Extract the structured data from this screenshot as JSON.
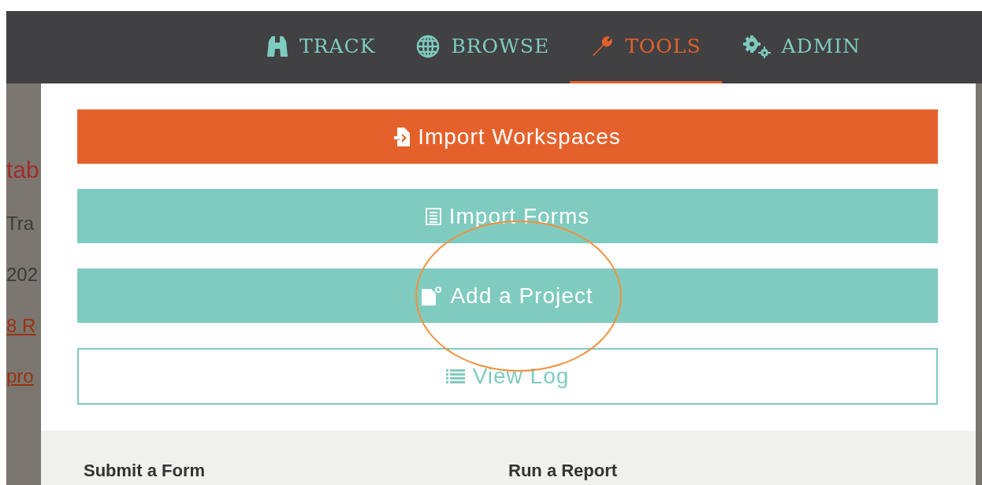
{
  "nav": [
    {
      "label": "TRACK",
      "selected": false
    },
    {
      "label": "BROWSE",
      "selected": false
    },
    {
      "label": "TOOLS",
      "selected": true
    },
    {
      "label": "ADMIN",
      "selected": false
    }
  ],
  "background_page": [
    {
      "kind": "heading",
      "text": "tab"
    },
    {
      "kind": "text",
      "text": "Tra"
    },
    {
      "kind": "text",
      "text": "202"
    },
    {
      "kind": "link",
      "text": "8 R"
    },
    {
      "kind": "link",
      "text": "pro"
    }
  ],
  "tools_menu": {
    "buttons": [
      {
        "label": "Import Workspaces",
        "kind": "primary",
        "circled": false
      },
      {
        "label": "Import Forms",
        "kind": "secondary",
        "circled": false
      },
      {
        "label": "Add a Project",
        "kind": "secondary",
        "circled": true
      },
      {
        "label": "View Log",
        "kind": "outline",
        "circled": false
      }
    ],
    "footer": [
      "Submit a Form",
      "Run a Report"
    ]
  }
}
